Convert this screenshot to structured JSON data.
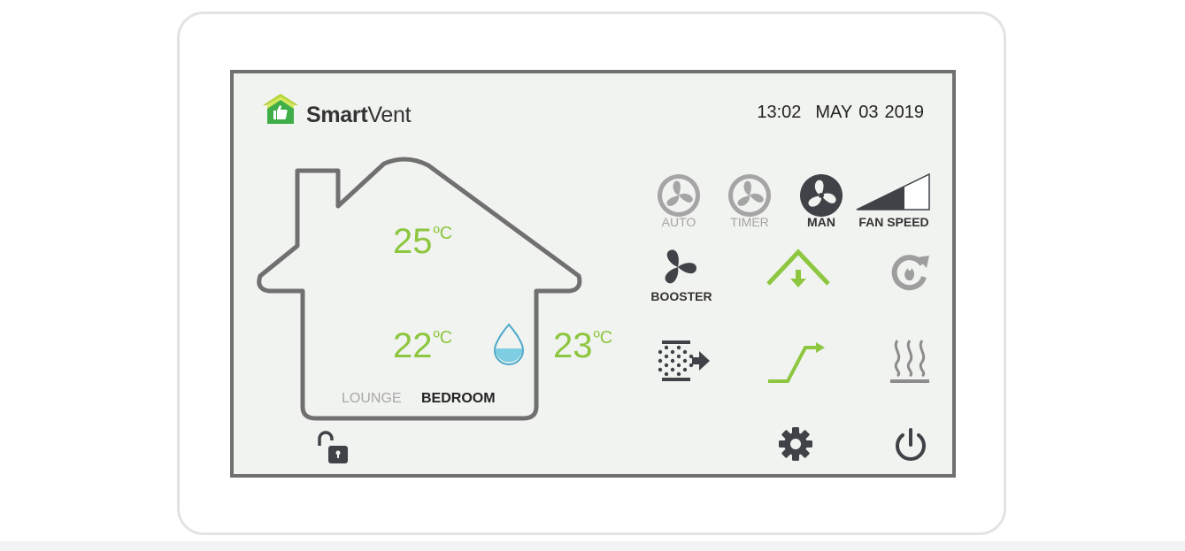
{
  "app": {
    "logo_bold": "Smart",
    "logo_regular": "Vent"
  },
  "status": {
    "time": "13:02",
    "month": "MAY",
    "day": "03",
    "year": "2019"
  },
  "house": {
    "top_temp": "25",
    "left_temp": "22",
    "right_temp": "23",
    "unit": "ºC",
    "rooms": [
      "LOUNGE",
      "BEDROOM"
    ],
    "active_room": "BEDROOM"
  },
  "modes": {
    "auto": "AUTO",
    "timer": "TIMER",
    "man": "MAN",
    "fan_speed": "FAN SPEED",
    "booster": "BOOSTER"
  },
  "colors": {
    "accent_green": "#8dc63f",
    "icon_dark": "#3f4347",
    "icon_dim": "#9e9e9e",
    "water": "#7fcde2",
    "frame": "#707070"
  },
  "icons": {
    "logo": "house-thumbs-up-icon",
    "auto": "fan-icon",
    "timer": "fan-icon",
    "man": "fan-icon",
    "fan_speed": "fan-speed-ramp-icon",
    "booster": "fan-icon",
    "summer_bypass": "roof-down-arrow-icon",
    "recirculation": "refresh-flame-icon",
    "filter": "filter-arrow-icon",
    "ramp": "step-arrow-icon",
    "heating": "heat-waves-icon",
    "humidity": "water-drop-icon",
    "lock": "unlocked-padlock-icon",
    "settings": "gear-icon",
    "power": "power-icon"
  }
}
